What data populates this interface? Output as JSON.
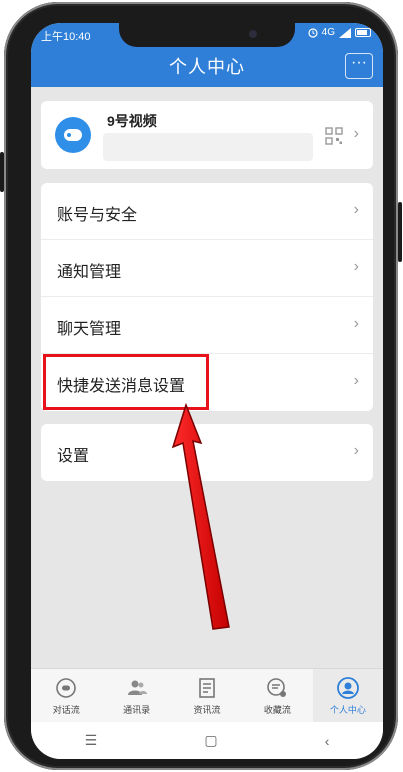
{
  "status": {
    "time": "上午10:40",
    "network": "4G"
  },
  "header": {
    "title": "个人中心",
    "more_label": "···"
  },
  "profile": {
    "name": "9号视频"
  },
  "menu_group_1": [
    {
      "label": "账号与安全"
    },
    {
      "label": "通知管理"
    },
    {
      "label": "聊天管理"
    },
    {
      "label": "快捷发送消息设置"
    }
  ],
  "menu_group_2": [
    {
      "label": "设置"
    }
  ],
  "tabs": [
    {
      "label": "对话流",
      "icon": "chat-bubble-icon"
    },
    {
      "label": "通讯录",
      "icon": "contacts-icon"
    },
    {
      "label": "资讯流",
      "icon": "news-icon"
    },
    {
      "label": "收藏流",
      "icon": "favorites-icon"
    },
    {
      "label": "个人中心",
      "icon": "person-icon",
      "active": true
    }
  ],
  "colors": {
    "primary": "#2f7fd8",
    "highlight": "#e8121b",
    "background": "#e6e6e6"
  }
}
